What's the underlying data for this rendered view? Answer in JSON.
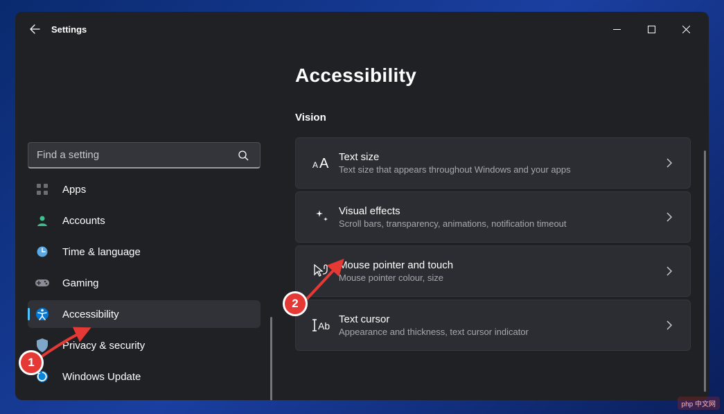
{
  "window": {
    "title": "Settings"
  },
  "search": {
    "placeholder": "Find a setting"
  },
  "nav": {
    "items": [
      {
        "key": "apps",
        "label": "Apps"
      },
      {
        "key": "accounts",
        "label": "Accounts"
      },
      {
        "key": "time",
        "label": "Time & language"
      },
      {
        "key": "gaming",
        "label": "Gaming"
      },
      {
        "key": "accessibility",
        "label": "Accessibility",
        "active": true
      },
      {
        "key": "privacy",
        "label": "Privacy & security"
      },
      {
        "key": "update",
        "label": "Windows Update"
      }
    ]
  },
  "page": {
    "title": "Accessibility",
    "section": "Vision",
    "cards": [
      {
        "key": "textsize",
        "title": "Text size",
        "subtitle": "Text size that appears throughout Windows and your apps"
      },
      {
        "key": "visualeffects",
        "title": "Visual effects",
        "subtitle": "Scroll bars, transparency, animations, notification timeout"
      },
      {
        "key": "mouse",
        "title": "Mouse pointer and touch",
        "subtitle": "Mouse pointer colour, size"
      },
      {
        "key": "textcursor",
        "title": "Text cursor",
        "subtitle": "Appearance and thickness, text cursor indicator"
      }
    ]
  },
  "annotations": {
    "badge1": "1",
    "badge2": "2"
  },
  "watermark": "php 中文网"
}
